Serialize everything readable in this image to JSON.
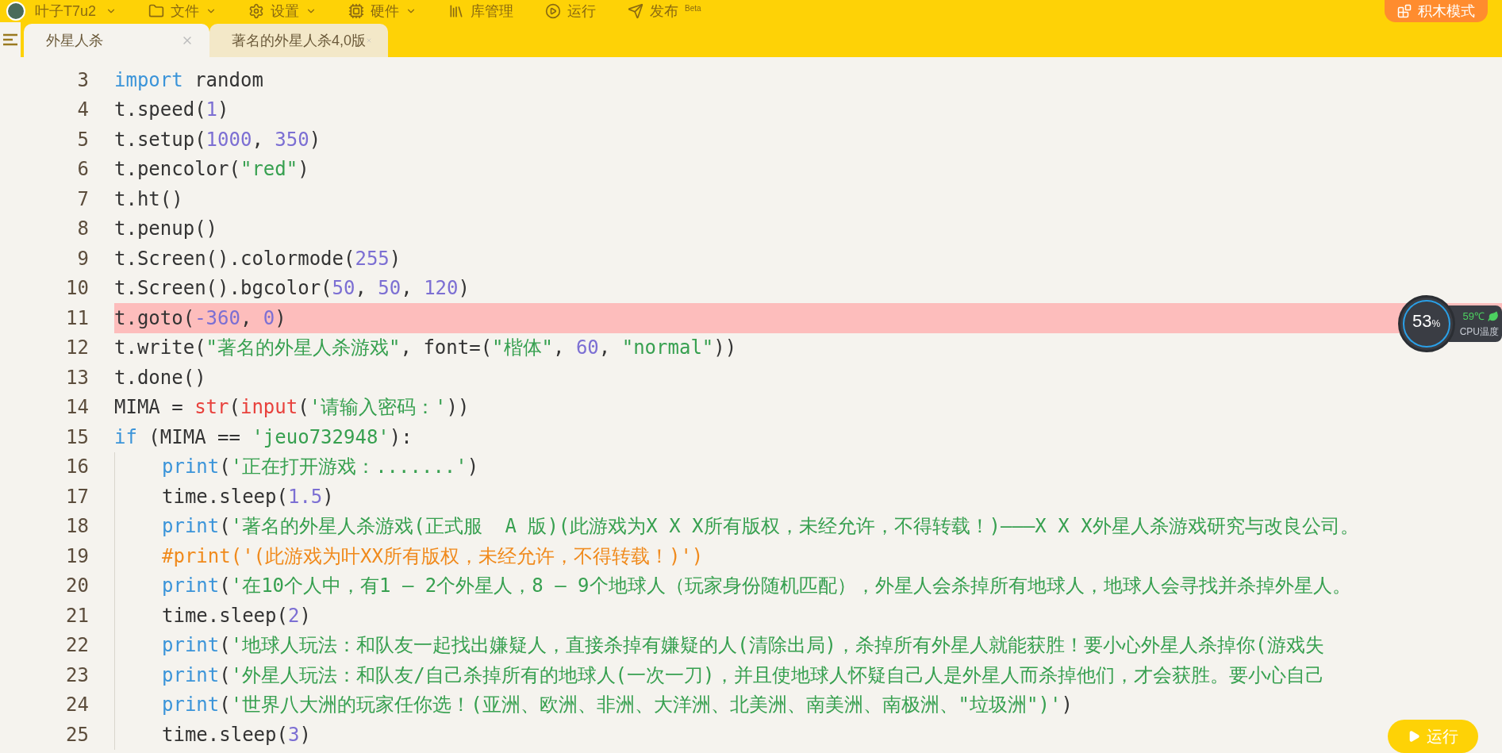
{
  "menu_bar": {
    "user": "叶子T7u2",
    "items": [
      {
        "label": "文件",
        "dropdown": true
      },
      {
        "label": "设置",
        "dropdown": true
      },
      {
        "label": "硬件",
        "dropdown": true
      },
      {
        "label": "库管理",
        "dropdown": false
      },
      {
        "label": "运行",
        "dropdown": false
      },
      {
        "label": "发布",
        "dropdown": false,
        "badge": "Beta"
      }
    ],
    "mode_button": "积木模式"
  },
  "tabs": [
    {
      "label": "外星人杀",
      "selected": true
    },
    {
      "label": "著名的外星人杀4,0版",
      "selected": false
    }
  ],
  "editor": {
    "lines": [
      {
        "number": "3",
        "indented": false,
        "highlighted": false,
        "tokens": [
          {
            "kind": "keyword",
            "text": "import"
          },
          {
            "kind": "plain",
            "text": " random"
          }
        ]
      },
      {
        "number": "4",
        "indented": false,
        "highlighted": false,
        "tokens": [
          {
            "kind": "plain",
            "text": "t.speed("
          },
          {
            "kind": "number",
            "text": "1"
          },
          {
            "kind": "plain",
            "text": ")"
          }
        ]
      },
      {
        "number": "5",
        "indented": false,
        "highlighted": false,
        "tokens": [
          {
            "kind": "plain",
            "text": "t.setup("
          },
          {
            "kind": "number",
            "text": "1000"
          },
          {
            "kind": "plain",
            "text": ", "
          },
          {
            "kind": "number",
            "text": "350"
          },
          {
            "kind": "plain",
            "text": ")"
          }
        ]
      },
      {
        "number": "6",
        "indented": false,
        "highlighted": false,
        "tokens": [
          {
            "kind": "plain",
            "text": "t.pencolor("
          },
          {
            "kind": "string",
            "text": "\"red\""
          },
          {
            "kind": "plain",
            "text": ")"
          }
        ]
      },
      {
        "number": "7",
        "indented": false,
        "highlighted": false,
        "tokens": [
          {
            "kind": "plain",
            "text": "t.ht()"
          }
        ]
      },
      {
        "number": "8",
        "indented": false,
        "highlighted": false,
        "tokens": [
          {
            "kind": "plain",
            "text": "t.penup()"
          }
        ]
      },
      {
        "number": "9",
        "indented": false,
        "highlighted": false,
        "tokens": [
          {
            "kind": "plain",
            "text": "t.Screen().colormode("
          },
          {
            "kind": "number",
            "text": "255"
          },
          {
            "kind": "plain",
            "text": ")"
          }
        ]
      },
      {
        "number": "10",
        "indented": false,
        "highlighted": false,
        "tokens": [
          {
            "kind": "plain",
            "text": "t.Screen().bgcolor("
          },
          {
            "kind": "number",
            "text": "50"
          },
          {
            "kind": "plain",
            "text": ", "
          },
          {
            "kind": "number",
            "text": "50"
          },
          {
            "kind": "plain",
            "text": ", "
          },
          {
            "kind": "number",
            "text": "120"
          },
          {
            "kind": "plain",
            "text": ")"
          }
        ]
      },
      {
        "number": "11",
        "indented": false,
        "highlighted": true,
        "tokens": [
          {
            "kind": "plain",
            "text": "t.goto("
          },
          {
            "kind": "number",
            "text": "-360"
          },
          {
            "kind": "plain",
            "text": ", "
          },
          {
            "kind": "number",
            "text": "0"
          },
          {
            "kind": "plain",
            "text": ")"
          }
        ]
      },
      {
        "number": "12",
        "indented": false,
        "highlighted": false,
        "tokens": [
          {
            "kind": "plain",
            "text": "t.write("
          },
          {
            "kind": "string",
            "text": "\"著名的外星人杀游戏\""
          },
          {
            "kind": "plain",
            "text": ", font=("
          },
          {
            "kind": "string",
            "text": "\"楷体\""
          },
          {
            "kind": "plain",
            "text": ", "
          },
          {
            "kind": "number",
            "text": "60"
          },
          {
            "kind": "plain",
            "text": ", "
          },
          {
            "kind": "string",
            "text": "\"normal\""
          },
          {
            "kind": "plain",
            "text": "))"
          }
        ]
      },
      {
        "number": "13",
        "indented": false,
        "highlighted": false,
        "tokens": [
          {
            "kind": "plain",
            "text": "t.done()"
          }
        ]
      },
      {
        "number": "14",
        "indented": false,
        "highlighted": false,
        "tokens": [
          {
            "kind": "plain",
            "text": "MIMA = "
          },
          {
            "kind": "builtin",
            "text": "str"
          },
          {
            "kind": "plain",
            "text": "("
          },
          {
            "kind": "builtin",
            "text": "input"
          },
          {
            "kind": "plain",
            "text": "("
          },
          {
            "kind": "string",
            "text": "'请输入密码：'"
          },
          {
            "kind": "plain",
            "text": "))"
          }
        ]
      },
      {
        "number": "15",
        "indented": false,
        "highlighted": false,
        "tokens": [
          {
            "kind": "keyword",
            "text": "if"
          },
          {
            "kind": "plain",
            "text": " (MIMA == "
          },
          {
            "kind": "string",
            "text": "'jeuo732948'"
          },
          {
            "kind": "plain",
            "text": "):"
          }
        ]
      },
      {
        "number": "16",
        "indented": true,
        "highlighted": false,
        "tokens": [
          {
            "kind": "keyword",
            "text": "print"
          },
          {
            "kind": "plain",
            "text": "("
          },
          {
            "kind": "string",
            "text": "'正在打开游戏：.......'"
          },
          {
            "kind": "plain",
            "text": ")"
          }
        ]
      },
      {
        "number": "17",
        "indented": true,
        "highlighted": false,
        "tokens": [
          {
            "kind": "plain",
            "text": "time.sleep("
          },
          {
            "kind": "number",
            "text": "1.5"
          },
          {
            "kind": "plain",
            "text": ")"
          }
        ]
      },
      {
        "number": "18",
        "indented": true,
        "highlighted": false,
        "tokens": [
          {
            "kind": "keyword",
            "text": "print"
          },
          {
            "kind": "plain",
            "text": "("
          },
          {
            "kind": "string",
            "text": "'著名的外星人杀游戏(正式服  A 版)(此游戏为X X X所有版权，未经允许，不得转载！)———X X X外星人杀游戏研究与改良公司。"
          }
        ]
      },
      {
        "number": "19",
        "indented": true,
        "highlighted": false,
        "tokens": [
          {
            "kind": "comment",
            "text": "#print('(此游戏为叶XX所有版权，未经允许，不得转载！)')"
          }
        ]
      },
      {
        "number": "20",
        "indented": true,
        "highlighted": false,
        "tokens": [
          {
            "kind": "keyword",
            "text": "print"
          },
          {
            "kind": "plain",
            "text": "("
          },
          {
            "kind": "string",
            "text": "'在10个人中，有1 — 2个外星人，8 — 9个地球人（玩家身份随机匹配），外星人会杀掉所有地球人，地球人会寻找并杀掉外星人。"
          }
        ]
      },
      {
        "number": "21",
        "indented": true,
        "highlighted": false,
        "tokens": [
          {
            "kind": "plain",
            "text": "time.sleep("
          },
          {
            "kind": "number",
            "text": "2"
          },
          {
            "kind": "plain",
            "text": ")"
          }
        ]
      },
      {
        "number": "22",
        "indented": true,
        "highlighted": false,
        "tokens": [
          {
            "kind": "keyword",
            "text": "print"
          },
          {
            "kind": "plain",
            "text": "("
          },
          {
            "kind": "string",
            "text": "'地球人玩法：和队友一起找出嫌疑人，直接杀掉有嫌疑的人(清除出局)，杀掉所有外星人就能获胜！要小心外星人杀掉你(游戏失"
          }
        ]
      },
      {
        "number": "23",
        "indented": true,
        "highlighted": false,
        "tokens": [
          {
            "kind": "keyword",
            "text": "print"
          },
          {
            "kind": "plain",
            "text": "("
          },
          {
            "kind": "string",
            "text": "'外星人玩法：和队友/自己杀掉所有的地球人(一次一刀)，并且使地球人怀疑自己人是外星人而杀掉他们，才会获胜。要小心自己"
          }
        ]
      },
      {
        "number": "24",
        "indented": true,
        "highlighted": false,
        "tokens": [
          {
            "kind": "keyword",
            "text": "print"
          },
          {
            "kind": "plain",
            "text": "("
          },
          {
            "kind": "string",
            "text": "'世界八大洲的玩家任你选！(亚洲、欧洲、非洲、大洋洲、北美洲、南美洲、南极洲、\"垃圾洲\")'"
          },
          {
            "kind": "plain",
            "text": ")"
          }
        ]
      },
      {
        "number": "25",
        "indented": true,
        "highlighted": false,
        "tokens": [
          {
            "kind": "plain",
            "text": "time.sleep("
          },
          {
            "kind": "number",
            "text": "3"
          },
          {
            "kind": "plain",
            "text": ")"
          }
        ]
      }
    ]
  },
  "cpu_monitor": {
    "usage": "53",
    "unit": "%",
    "temperature": "59℃",
    "label": "CPU温度"
  },
  "run_button": {
    "label": "运行"
  }
}
